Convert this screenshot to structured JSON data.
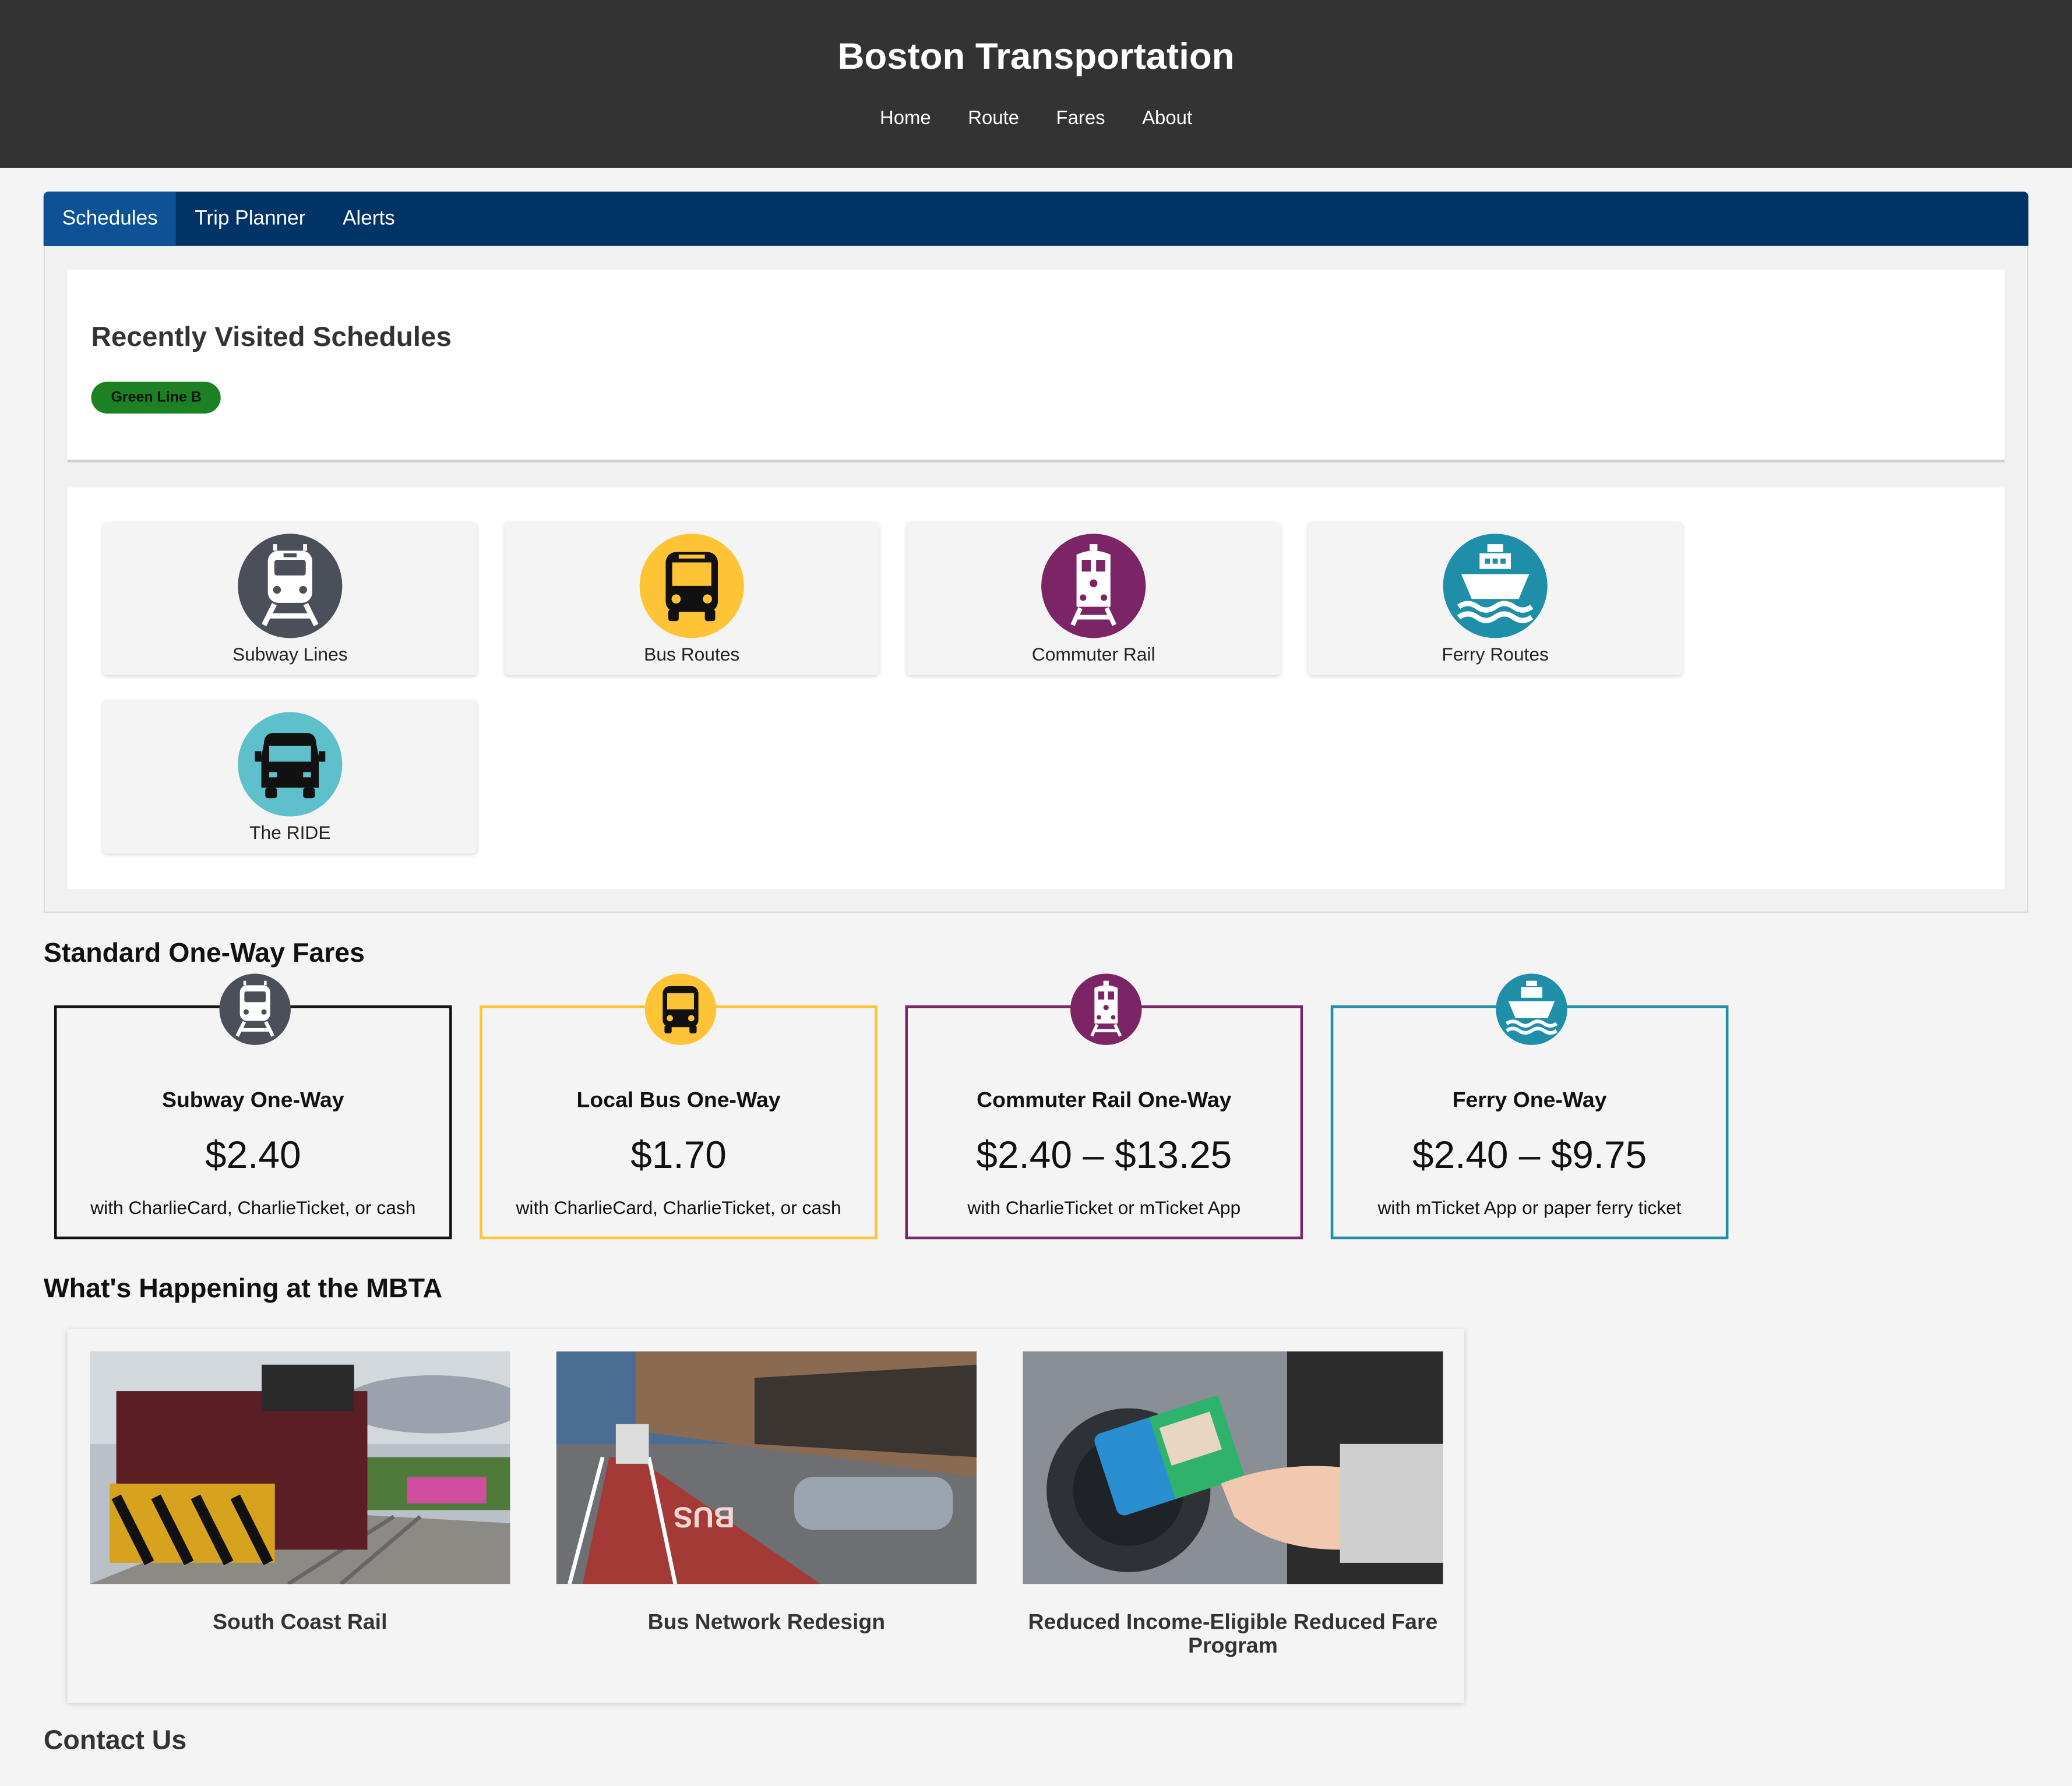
{
  "header": {
    "title": "Boston Transportation",
    "nav": [
      "Home",
      "Route",
      "Fares",
      "About"
    ]
  },
  "tabs": [
    {
      "label": "Schedules",
      "active": true
    },
    {
      "label": "Trip Planner"
    },
    {
      "label": "Alerts"
    }
  ],
  "recent": {
    "title": "Recently Visited Schedules",
    "pill": "Green Line B",
    "pill_color": "#1c8122"
  },
  "modes": [
    {
      "label": "Subway Lines",
      "icon": "subway-icon",
      "color": "#4a4f59"
    },
    {
      "label": "Bus Routes",
      "icon": "bus-icon",
      "color": "#fec435"
    },
    {
      "label": "Commuter Rail",
      "icon": "commuter-rail-icon",
      "color": "#7b2466"
    },
    {
      "label": "Ferry Routes",
      "icon": "ferry-icon",
      "color": "#1e8ea9"
    },
    {
      "label": "The RIDE",
      "icon": "ride-van-icon",
      "color": "#5ec0cb"
    }
  ],
  "fares": {
    "heading": "Standard One-Way Fares",
    "items": [
      {
        "title": "Subway One-Way",
        "price": "$2.40",
        "note": "with CharlieCard, CharlieTicket, or cash",
        "color": "#111111",
        "icon": "subway-icon"
      },
      {
        "title": "Local Bus One-Way",
        "price": "$1.70",
        "note": "with CharlieCard, CharlieTicket, or cash",
        "color": "#fec435",
        "icon": "bus-icon"
      },
      {
        "title": "Commuter Rail One-Way",
        "price": "$2.40 – $13.25",
        "note": "with CharlieTicket or mTicket App",
        "color": "#7b2466",
        "icon": "commuter-rail-icon"
      },
      {
        "title": "Ferry One-Way",
        "price": "$2.40 – $9.75",
        "note": "with mTicket App or paper ferry ticket",
        "color": "#1e8ea9",
        "icon": "ferry-icon"
      }
    ]
  },
  "news": {
    "heading": "What's Happening at the MBTA",
    "items": [
      {
        "title": "South Coast Rail"
      },
      {
        "title": "Bus Network Redesign"
      },
      {
        "title": "Reduced Income-Eligible Reduced Fare Program"
      }
    ]
  },
  "contact": {
    "heading": "Contact Us"
  }
}
